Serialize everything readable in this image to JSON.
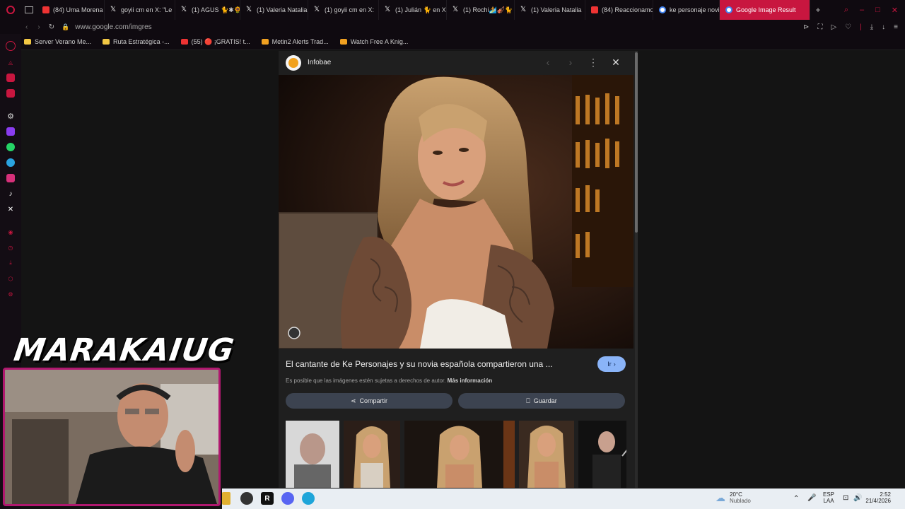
{
  "tabs": [
    {
      "label": "(84) Uma Morena",
      "icon": "youtube-icon",
      "color": "#e33"
    },
    {
      "label": "goyii cm en X: \"Le",
      "icon": "x-icon",
      "color": "#fff"
    },
    {
      "label": "(1) AGUS 🐈✱🌻",
      "icon": "x-icon",
      "color": "#fff"
    },
    {
      "label": "(1) Valeria Natalia",
      "icon": "x-icon",
      "color": "#fff"
    },
    {
      "label": "(1) goyii cm en X:",
      "icon": "x-icon",
      "color": "#fff"
    },
    {
      "label": "(1) Julián 🐈 en X",
      "icon": "x-icon",
      "color": "#fff"
    },
    {
      "label": "(1) Rochi🏄🎻🐈",
      "icon": "x-icon",
      "color": "#fff"
    },
    {
      "label": "(1) Valeria Natalia",
      "icon": "x-icon",
      "color": "#fff"
    },
    {
      "label": "(84) Reaccionamo",
      "icon": "youtube-icon",
      "color": "#e33"
    },
    {
      "label": "ke personaje novi",
      "icon": "google-icon",
      "color": "#4285f4"
    },
    {
      "label": "Google Image Result",
      "icon": "google-icon",
      "color": "#4285f4"
    }
  ],
  "address": {
    "url": "www.google.com/imgres"
  },
  "bookmarks": [
    {
      "label": "Server Verano Me...",
      "icon": "folder-icon",
      "color": "#f2c744"
    },
    {
      "label": "Ruta Estratégica -...",
      "icon": "folder-icon",
      "color": "#f2c744"
    },
    {
      "label": "(55) 🔴 ¡GRATIS! t...",
      "icon": "youtube-icon",
      "color": "#e33"
    },
    {
      "label": "Metin2 Alerts Trad...",
      "icon": "metin-icon",
      "color": "#f0a020"
    },
    {
      "label": "Watch Free A Knig...",
      "icon": "watch-icon",
      "color": "#f0a020"
    }
  ],
  "panel": {
    "source": "Infobae",
    "caption": "El cantante de Ke Personajes y su novia española compartieron una ...",
    "go_label": "Ir",
    "copyright": "Es posible que las imágenes estén sujetas a derechos de autor.",
    "more_info": "Más información",
    "share_label": "Compartir",
    "save_label": "Guardar"
  },
  "overlay": {
    "logo_text": "MARAKAIUG"
  },
  "taskbar": {
    "weather_temp": "20°C",
    "weather_desc": "Nublado",
    "lang": "ESP",
    "lang_sub": "LAA",
    "time": "2:52",
    "date": "21/4/2026"
  }
}
